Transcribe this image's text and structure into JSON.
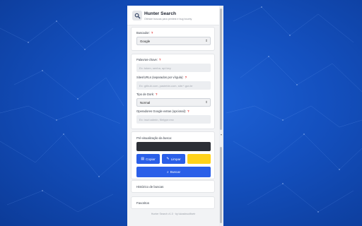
{
  "popup": {
    "title": "Hunter Search",
    "subtitle": "Otimize buscas para pentest e bug bounty",
    "engine": {
      "label": "Buscador:",
      "value": "Google"
    },
    "keywords": {
      "label": "Palavras-chave:",
      "placeholder": "Ex: token, senha, api key"
    },
    "sites": {
      "label": "Sites/URLs (separados por vírgula):",
      "placeholder": "Ex: github.com, pastebin.com, site:*.gov.br"
    },
    "dork": {
      "label": "Tipo de Dork:",
      "value": "Normal"
    },
    "operators": {
      "label": "Operadores Google extras (opcional):",
      "placeholder": "Ex: inurl:admin, filetype:env"
    },
    "preview": {
      "label": "Pré-visualização da busca:",
      "value": ""
    },
    "buttons": {
      "copy": "Copiar",
      "clear": "Limpar",
      "search": "Buscar"
    },
    "history_title": "Histórico de buscas",
    "favorites_title": "Favoritos",
    "footer": "Hunter Search v1.0 · by luizadnuolliveir"
  },
  "icons": {
    "logo": "magnifier-icon",
    "help": "question-icon",
    "copy": "clipboard-icon",
    "clear": "broom-icon",
    "search": "search-icon",
    "caret": "chevron-down-icon"
  },
  "colors": {
    "background": "#1450bf",
    "primary_button": "#2a5fe8",
    "accent_button": "#ffd21a",
    "help": "#e03131",
    "preview_bg": "#2c2f36"
  }
}
